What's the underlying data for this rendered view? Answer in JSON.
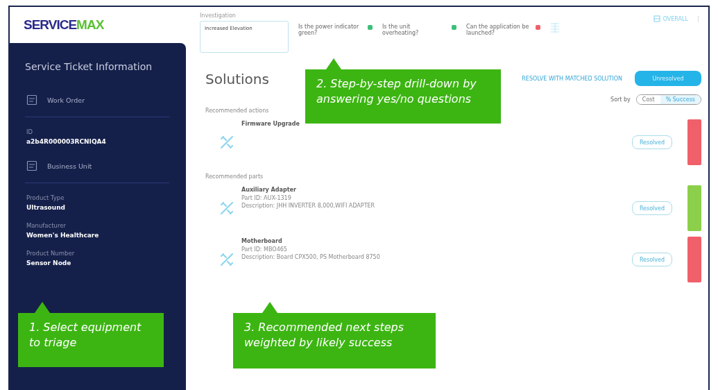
{
  "logo": {
    "part_1": "SERVICE",
    "part_2": "MAX"
  },
  "sidebar": {
    "title": "Service Ticket Information",
    "sections": [
      {
        "kind": "header",
        "label": "Work Order"
      },
      {
        "kind": "field",
        "label": "ID",
        "value": "a2b4R000003RCNIQA4"
      },
      {
        "kind": "header",
        "label": "Business Unit"
      },
      {
        "kind": "field",
        "label": "Product Type",
        "value": "Ultrasound"
      },
      {
        "kind": "field",
        "label": "Manufacturer",
        "value": "Women's Healthcare"
      },
      {
        "kind": "field",
        "label": "Product Number",
        "value": "Sensor Node"
      }
    ]
  },
  "investigation": {
    "label": "Investigation",
    "value": "Increased Elevation",
    "questions": [
      {
        "text": "Is the power indicator green?",
        "color": "#3dbf7a"
      },
      {
        "text": "Is the unit overheating?",
        "color": "#3dbf7a"
      },
      {
        "text": "Can the application be launched?",
        "color": "#f0606a"
      }
    ]
  },
  "top_right": {
    "label": "OVERALL",
    "menu": "⋮"
  },
  "solutions": {
    "title": "Solutions",
    "resolve_link": "RESOLVE WITH MATCHED SOLUTION",
    "status_button": "Unresolved",
    "sort_label": "Sort by",
    "sort_options": [
      {
        "label": "Cost",
        "selected": false
      },
      {
        "label": "% Success",
        "selected": true
      }
    ],
    "groups": [
      {
        "heading": "Recommended actions",
        "items": [
          {
            "name": "Firmware Upgrade",
            "button": "Resolved",
            "color": "#f0606a"
          }
        ]
      },
      {
        "heading": "Recommended parts",
        "items": [
          {
            "name": "Auxiliary Adapter",
            "part_id": "Part ID: AUX-1319",
            "description": "Description: JHH INVERTER 8,000,WIFI ADAPTER",
            "button": "Resolved",
            "color": "#8ccf4a"
          },
          {
            "name": "Motherboard",
            "part_id": "Part ID: MBO465",
            "description": "Description: Board CPX500, PS Motherboard 8750",
            "button": "Resolved",
            "color": "#f0606a"
          }
        ]
      }
    ]
  },
  "callouts": [
    {
      "text": "1. Select equipment to triage"
    },
    {
      "text": "2. Step-by-step drill-down by answering yes/no questions"
    },
    {
      "text": "3. Recommended next steps weighted by likely success"
    }
  ]
}
